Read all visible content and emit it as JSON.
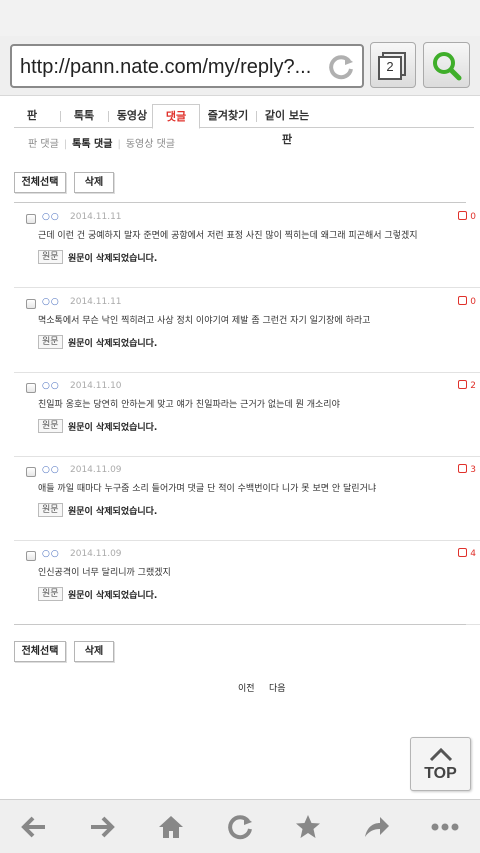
{
  "browser": {
    "url": "http://pann.nate.com/my/reply?...",
    "tab_count": "2"
  },
  "nav": {
    "items": [
      {
        "label": "판"
      },
      {
        "label": "톡톡"
      },
      {
        "label": "동영상"
      },
      {
        "label": "댓글",
        "active": true
      },
      {
        "label": "즐겨찾기"
      },
      {
        "label": "같이 보는 판"
      }
    ]
  },
  "subnav": {
    "items": [
      {
        "label": "판 댓글"
      },
      {
        "label": "톡톡 댓글",
        "active": true
      },
      {
        "label": "동영상 댓글"
      }
    ]
  },
  "actions": {
    "select_all": "전체선택",
    "delete": "삭제"
  },
  "comments": [
    {
      "author": "○○",
      "date": "2014.11.11",
      "likes": "0",
      "text": "근데 이런 건 궁예하지 말자 준면에 공항에서 저런 표정 사진 많이 찍히는데 왜그래 피곤해서 그렇겠지",
      "orig_badge": "원문",
      "orig_text": "원문이 삭제되었습니다."
    },
    {
      "author": "○○",
      "date": "2014.11.11",
      "likes": "0",
      "text": "멱소톡에서 무슨 낙인 찍히려고 사상 정치 이야기여 제발 좀 그런건 자기 일기장에 하라고",
      "orig_badge": "원문",
      "orig_text": "원문이 삭제되었습니다."
    },
    {
      "author": "○○",
      "date": "2014.11.10",
      "likes": "2",
      "text": "친일파 옹호는 당연히 안하는게 맞고 얘가 친일파라는 근거가 없는데 뭔 개소리야",
      "orig_badge": "원문",
      "orig_text": "원문이 삭제되었습니다."
    },
    {
      "author": "○○",
      "date": "2014.11.09",
      "likes": "3",
      "text": "애들 까일 때마다 누구줌 소리 들어가며 댓글 단 적이 수백번이다 니가 못 보면 안 달린거냐",
      "orig_badge": "원문",
      "orig_text": "원문이 삭제되었습니다."
    },
    {
      "author": "○○",
      "date": "2014.11.09",
      "likes": "4",
      "text": "인신공격이 너무 달리니까 그랬겠지",
      "orig_badge": "원문",
      "orig_text": "원문이 삭제되었습니다."
    }
  ],
  "pager": {
    "prev": "이전",
    "next": "다음"
  },
  "top_button": "TOP",
  "colors": {
    "accent_red": "#e0312b",
    "author_blue": "#4a6fbf",
    "search_green": "#3fae2a"
  },
  "toolbar": {
    "icons": [
      "back-arrow-icon",
      "forward-arrow-icon",
      "home-icon",
      "refresh-icon",
      "bookmark-star-icon",
      "share-icon",
      "more-icon"
    ]
  }
}
